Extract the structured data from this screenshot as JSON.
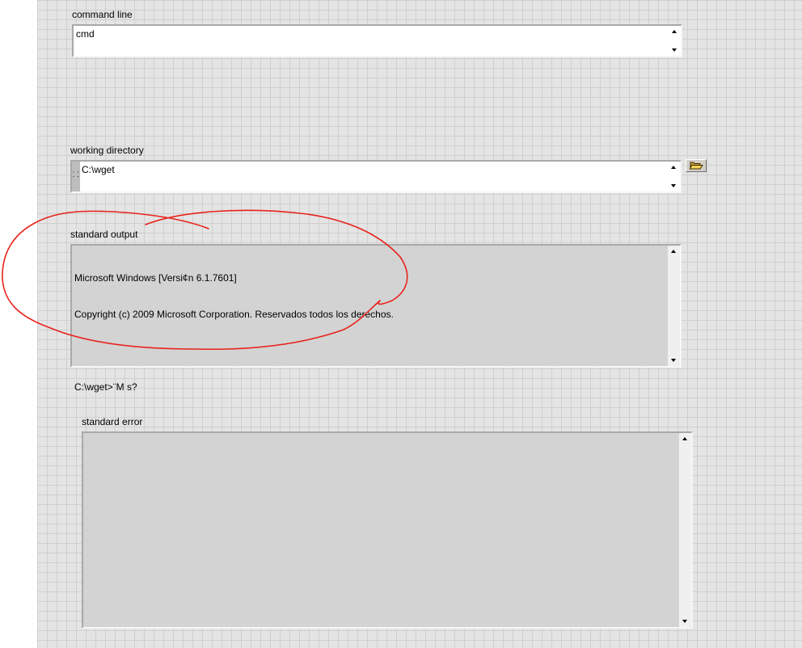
{
  "command_line": {
    "label": "command line",
    "value": "cmd"
  },
  "working_directory": {
    "label": "working directory",
    "value": "C:\\wget"
  },
  "standard_output": {
    "label": "standard output",
    "lines": [
      "Microsoft Windows [Versi¢n 6.1.7601]",
      "Copyright (c) 2009 Microsoft Corporation. Reservados todos los derechos.",
      "",
      "C:\\wget>¨M s?"
    ]
  },
  "standard_error": {
    "label": "standard error",
    "value": ""
  },
  "icons": {
    "folder": "folder-open-icon",
    "path": "path-icon",
    "scroll_up": "scroll-up-arrow-icon",
    "scroll_down": "scroll-down-arrow-icon"
  },
  "colors": {
    "panel_background": "#e4e4e4",
    "grid_line": "#cfcfcf",
    "indicator_background": "#d3d3d3",
    "annotation": "#e8221c"
  }
}
